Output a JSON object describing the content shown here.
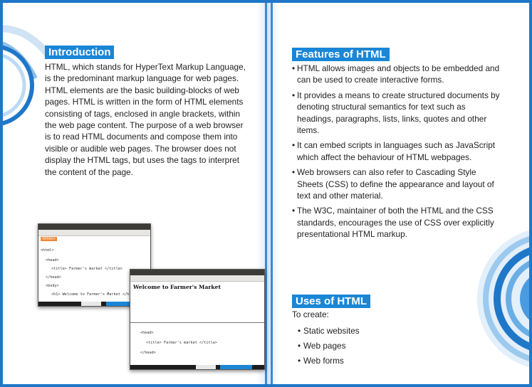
{
  "introduction": {
    "title": "Introduction",
    "text": "HTML, which stands for HyperText Markup Language, is the predominant markup language for web pages. HTML elements are the basic building-blocks of web pages. HTML is written in the form of HTML elements consisting of tags, enclosed in angle brackets, within the web page content. The purpose of a web browser is to read HTML documents and compose them into visible or audible web pages. The browser does not display the HTML tags, but uses the tags to interpret the content of the page."
  },
  "editor_window": {
    "code_lines": [
      "<html>",
      "<head>",
      "<title> Farmer's market </title>",
      "</head>",
      "<body>",
      "<h1> Welcome to Farmer's Market </h1>"
    ]
  },
  "browser_window": {
    "heading": "Welcome to Farmer's Market",
    "code_lines": [
      "<head>",
      "<title> Farmer's market </title>",
      "</head>"
    ]
  },
  "features": {
    "title": "Features of HTML",
    "items": [
      "HTML allows images and objects to be embedded and can be used to create interactive forms.",
      "It provides a means to create structured documents by denoting structural semantics for text such as headings, paragraphs, lists, links, quotes and other items.",
      "It can embed scripts in languages such as JavaScript which affect the behaviour of HTML webpages.",
      "Web browsers can also refer to Cascading Style Sheets (CSS) to define the appearance and layout of text and other material.",
      "The W3C, maintainer of both the HTML and the CSS standards, encourages the use of CSS over explicitly presentational HTML markup."
    ]
  },
  "uses": {
    "title": "Uses of HTML",
    "intro": "To create:",
    "items": [
      "Static websites",
      "Web pages",
      "Web forms"
    ]
  },
  "colors": {
    "accent": "#1a86d6",
    "frame": "#1f77c8"
  }
}
